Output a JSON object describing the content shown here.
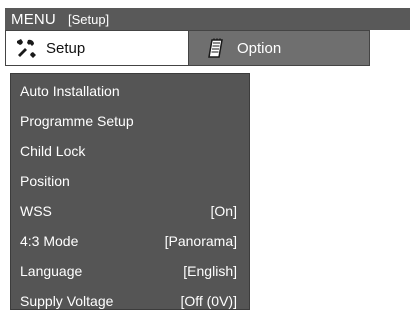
{
  "header": {
    "title": "MENU",
    "section": "[Setup]"
  },
  "tabs": [
    {
      "label": "Setup",
      "icon": "wrench-icon",
      "selected": true
    },
    {
      "label": "Option",
      "icon": "notepad-icon",
      "selected": false
    }
  ],
  "menu": {
    "items": [
      {
        "label": "Auto Installation",
        "value": ""
      },
      {
        "label": "Programme Setup",
        "value": ""
      },
      {
        "label": "Child Lock",
        "value": ""
      },
      {
        "label": "Position",
        "value": ""
      },
      {
        "label": "WSS",
        "value": "[On]"
      },
      {
        "label": "4:3 Mode",
        "value": "[Panorama]"
      },
      {
        "label": "Language",
        "value": "[English]"
      },
      {
        "label": "Supply Voltage",
        "value": "[Off (0V)]"
      }
    ]
  },
  "colors": {
    "title_bar": "#595959",
    "panel": "#555555",
    "tab_inactive": "#6f6f6f",
    "text": "#ffffff"
  }
}
